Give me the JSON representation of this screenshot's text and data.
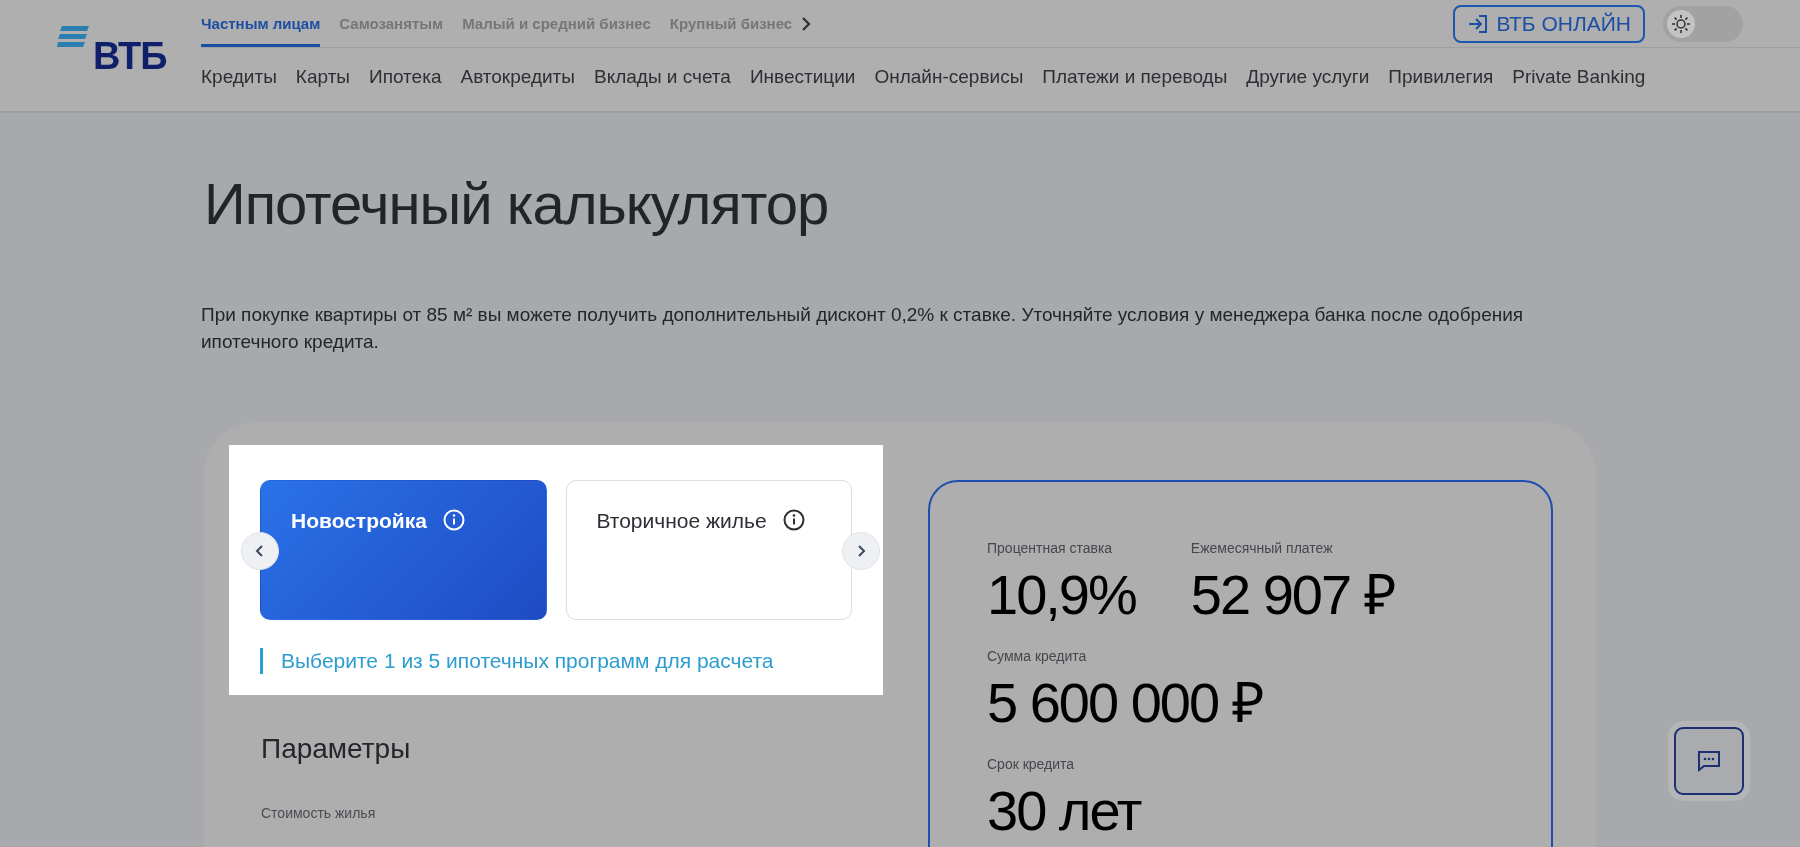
{
  "header": {
    "logo": "ВТБ",
    "segments": [
      {
        "label": "Частным лицам",
        "selected": true
      },
      {
        "label": "Самозанятым",
        "selected": false
      },
      {
        "label": "Малый и средний бизнес",
        "selected": false
      },
      {
        "label": "Крупный бизнес",
        "selected": false
      }
    ],
    "login_button": "ВТБ ОНЛАЙН",
    "theme_toggle": {
      "on": false
    },
    "nav": [
      "Кредиты",
      "Карты",
      "Ипотека",
      "Автокредиты",
      "Вклады и счета",
      "Инвестиции",
      "Онлайн-сервисы",
      "Платежи и переводы",
      "Другие услуги",
      "Привилегия",
      "Private Banking"
    ]
  },
  "title": "Ипотечный калькулятор",
  "notice": "При покупке квартиры от 85 м² вы можете получить дополнительный дисконт 0,2% к ставке. Уточняйте условия у менеджера банка после одобрения ипотечного кредита.",
  "calculator": {
    "property_types": [
      {
        "label": "Новостройка",
        "selected": true
      },
      {
        "label": "Вторичное жилье",
        "selected": false
      }
    ],
    "hint": "Выберите 1 из 5 ипотечных программ для расчета",
    "parameters_title": "Параметры",
    "parameters": [
      {
        "label": "Стоимость жилья"
      }
    ],
    "results": [
      {
        "label": "Процентная ставка",
        "value": "10,9%"
      },
      {
        "label": "Ежемесячный платеж",
        "value": "52 907 ₽"
      },
      {
        "label": "Сумма кредита",
        "value": "5 600 000 ₽"
      },
      {
        "label": "Срок кредита",
        "value": "30 лет"
      }
    ]
  }
}
